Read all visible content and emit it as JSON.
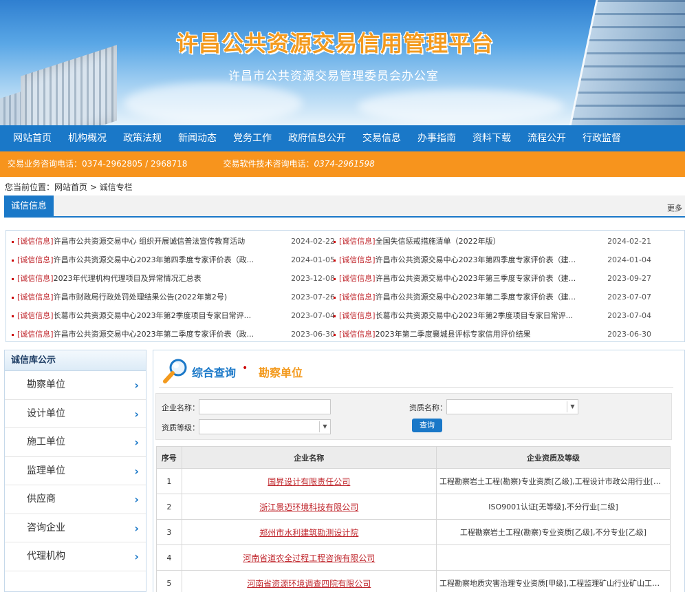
{
  "banner": {
    "title": "许昌公共资源交易信用管理平台",
    "subtitle": "许昌市公共资源交易管理委员会办公室"
  },
  "nav": [
    "网站首页",
    "机构概况",
    "政策法规",
    "新闻动态",
    "党务工作",
    "政府信息公开",
    "交易信息",
    "办事指南",
    "资料下载",
    "流程公开",
    "行政监督"
  ],
  "hotline": {
    "business": "交易业务咨询电话：0374-2962805 / 2968718",
    "software_label": "交易软件技术咨询电话：",
    "software_number": "0374-2961598"
  },
  "breadcrumb": "您当前位置：网站首页 > 诚信专栏",
  "section": {
    "tab": "诚信信息",
    "more": "更多"
  },
  "news": {
    "left": [
      {
        "tag": "[诚信信息]",
        "title": "许昌市公共资源交易中心 组织开展诚信普法宣传教育活动",
        "date": "2024-02-22"
      },
      {
        "tag": "[诚信信息]",
        "title": "许昌市公共资源交易中心2023年第四季度专家评价表（政...",
        "date": "2024-01-05"
      },
      {
        "tag": "[诚信信息]",
        "title": "2023年代理机构代理项目及异常情况汇总表",
        "date": "2023-12-08"
      },
      {
        "tag": "[诚信信息]",
        "title": "许昌市财政局行政处罚处理结果公告(2022年第2号)",
        "date": "2023-07-26"
      },
      {
        "tag": "[诚信信息]",
        "title": "长葛市公共资源交易中心2023年第2季度项目专家日常评...",
        "date": "2023-07-04"
      },
      {
        "tag": "[诚信信息]",
        "title": "许昌市公共资源交易中心2023年第二季度专家评价表（政...",
        "date": "2023-06-30"
      }
    ],
    "right": [
      {
        "tag": "[诚信信息]",
        "title": "全国失信惩戒措施清单（2022年版）",
        "date": "2024-02-21"
      },
      {
        "tag": "[诚信信息]",
        "title": "许昌市公共资源交易中心2023年第四季度专家评价表（建...",
        "date": "2024-01-04"
      },
      {
        "tag": "[诚信信息]",
        "title": "许昌市公共资源交易中心2023年第三季度专家评价表（建...",
        "date": "2023-09-27"
      },
      {
        "tag": "[诚信信息]",
        "title": "许昌市公共资源交易中心2023年第二季度专家评价表（建...",
        "date": "2023-07-07"
      },
      {
        "tag": "[诚信信息]",
        "title": "长葛市公共资源交易中心2023年第2季度项目专家日常评...",
        "date": "2023-07-04"
      },
      {
        "tag": "[诚信信息]",
        "title": "2023年第二季度襄城县评标专家信用评价结果",
        "date": "2023-06-30"
      }
    ]
  },
  "sidebar": {
    "title": "诚信库公示",
    "items": [
      "勘察单位",
      "设计单位",
      "施工单位",
      "监理单位",
      "供应商",
      "咨询企业",
      "代理机构"
    ]
  },
  "query": {
    "title": "综合查询",
    "bullet": "•",
    "category": "勘察单位",
    "company_label": "企业名称：",
    "qual_name_label": "资质名称：",
    "qual_level_label": "资质等级：",
    "search_button": "查询"
  },
  "table": {
    "headers": [
      "序号",
      "企业名称",
      "企业资质及等级"
    ],
    "rows": [
      {
        "no": "1",
        "name": "国昇设计有限责任公司",
        "qual": "工程勘察岩土工程(勘察)专业资质[乙级],工程设计市政公用行业[乙级..."
      },
      {
        "no": "2",
        "name": "浙江景迈环境科技有限公司",
        "qual": "ISO9001认证[无等级],不分行业[二级]"
      },
      {
        "no": "3",
        "name": "郑州市水利建筑勘测设计院",
        "qual": "工程勘察岩土工程(勘察)专业资质[乙级],不分专业[乙级]"
      },
      {
        "no": "4",
        "name": "河南省道农全过程工程咨询有限公司",
        "qual": ""
      },
      {
        "no": "5",
        "name": "河南省资源环境调查四院有限公司",
        "qual": "工程勘察地质灾害治理专业资质[甲级],工程监理矿山行业矿山工程专..."
      }
    ]
  },
  "colors": {
    "nav_blue": "#1a78c8",
    "hotline_orange": "#f7941d",
    "title_orange": "#f39a1e",
    "tag_red": "#c0272d"
  }
}
